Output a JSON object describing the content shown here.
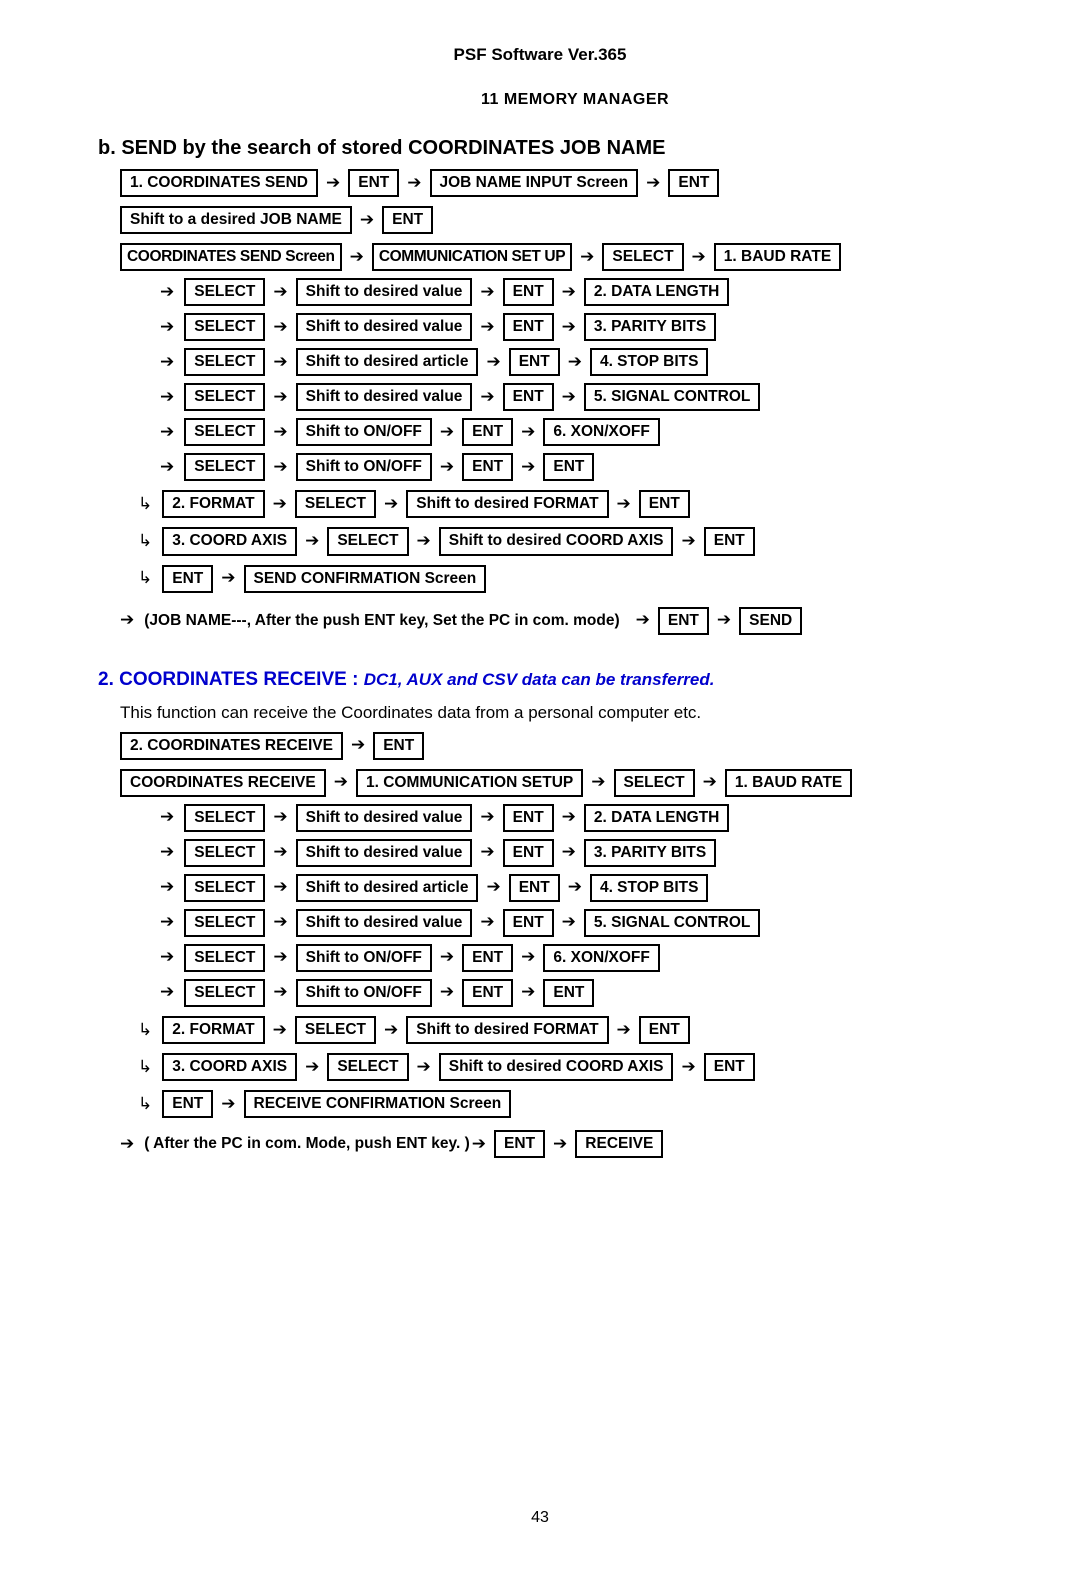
{
  "header": {
    "software": "PSF Software Ver.365",
    "chapter": "11  MEMORY MANAGER"
  },
  "section_b": {
    "title": "b. SEND by the search of stored COORDINATES JOB NAME",
    "rows": [
      {
        "items": [
          {
            "type": "box",
            "text": "1. COORDINATES SEND"
          },
          {
            "type": "arrow",
            "text": "➔"
          },
          {
            "type": "box",
            "text": "ENT"
          },
          {
            "type": "arrow",
            "text": "➔"
          },
          {
            "type": "box",
            "text": "JOB NAME INPUT Screen"
          },
          {
            "type": "arrow",
            "text": "➔"
          },
          {
            "type": "box",
            "text": "ENT"
          }
        ]
      },
      {
        "items": [
          {
            "type": "box",
            "text": "Shift to a desired JOB NAME"
          },
          {
            "type": "arrow",
            "text": "➔"
          },
          {
            "type": "box",
            "text": "ENT"
          }
        ]
      },
      {
        "items": [
          {
            "type": "box",
            "text": "COORDINATES SEND Screen"
          },
          {
            "type": "arrow",
            "text": "➔"
          },
          {
            "type": "box",
            "text": "COMMUNICATION SET UP"
          },
          {
            "type": "arrow",
            "text": "➔"
          },
          {
            "type": "box",
            "text": "SELECT"
          },
          {
            "type": "arrow",
            "text": "➔"
          },
          {
            "type": "box",
            "text": "1. BAUD RATE"
          }
        ]
      }
    ],
    "sub_rows": [
      {
        "items": [
          {
            "type": "arrow",
            "text": "➔"
          },
          {
            "type": "box",
            "text": "SELECT"
          },
          {
            "type": "arrow",
            "text": "➔"
          },
          {
            "type": "box",
            "text": "Shift to desired value"
          },
          {
            "type": "arrow",
            "text": "➔"
          },
          {
            "type": "box",
            "text": "ENT"
          },
          {
            "type": "arrow",
            "text": "➔"
          },
          {
            "type": "box",
            "text": "2. DATA LENGTH"
          }
        ]
      },
      {
        "items": [
          {
            "type": "arrow",
            "text": "➔"
          },
          {
            "type": "box",
            "text": "SELECT"
          },
          {
            "type": "arrow",
            "text": "➔"
          },
          {
            "type": "box",
            "text": "Shift to desired value"
          },
          {
            "type": "arrow",
            "text": "➔"
          },
          {
            "type": "box",
            "text": "ENT"
          },
          {
            "type": "arrow",
            "text": "➔"
          },
          {
            "type": "box",
            "text": "3. PARITY BITS"
          }
        ]
      },
      {
        "items": [
          {
            "type": "arrow",
            "text": "➔"
          },
          {
            "type": "box",
            "text": "SELECT"
          },
          {
            "type": "arrow",
            "text": "➔"
          },
          {
            "type": "box",
            "text": "Shift to desired article"
          },
          {
            "type": "arrow",
            "text": "➔"
          },
          {
            "type": "box",
            "text": "ENT"
          },
          {
            "type": "arrow",
            "text": "➔"
          },
          {
            "type": "box",
            "text": "4. STOP BITS"
          }
        ]
      },
      {
        "items": [
          {
            "type": "arrow",
            "text": "➔"
          },
          {
            "type": "box",
            "text": "SELECT"
          },
          {
            "type": "arrow",
            "text": "➔"
          },
          {
            "type": "box",
            "text": "Shift to desired value"
          },
          {
            "type": "arrow",
            "text": "➔"
          },
          {
            "type": "box",
            "text": "ENT"
          },
          {
            "type": "arrow",
            "text": "➔"
          },
          {
            "type": "box",
            "text": "5. SIGNAL CONTROL"
          }
        ]
      },
      {
        "items": [
          {
            "type": "arrow",
            "text": "➔"
          },
          {
            "type": "box",
            "text": "SELECT"
          },
          {
            "type": "arrow",
            "text": "➔"
          },
          {
            "type": "box",
            "text": "Shift to ON/OFF"
          },
          {
            "type": "arrow",
            "text": "➔"
          },
          {
            "type": "box",
            "text": "ENT"
          },
          {
            "type": "arrow",
            "text": "➔"
          },
          {
            "type": "box",
            "text": "6. XON/XOFF"
          }
        ]
      },
      {
        "items": [
          {
            "type": "arrow",
            "text": "➔"
          },
          {
            "type": "box",
            "text": "SELECT"
          },
          {
            "type": "arrow",
            "text": "➔"
          },
          {
            "type": "box",
            "text": "Shift to ON/OFF"
          },
          {
            "type": "arrow",
            "text": "➔"
          },
          {
            "type": "box",
            "text": "ENT"
          },
          {
            "type": "arrow",
            "text": "➔"
          },
          {
            "type": "box",
            "text": "ENT"
          }
        ]
      }
    ],
    "hook_rows": [
      {
        "items": [
          {
            "type": "arrow",
            "text": "↳"
          },
          {
            "type": "box",
            "text": "2. FORMAT"
          },
          {
            "type": "arrow",
            "text": "➔"
          },
          {
            "type": "box",
            "text": "SELECT"
          },
          {
            "type": "arrow",
            "text": "➔"
          },
          {
            "type": "box",
            "text": "Shift to desired FORMAT"
          },
          {
            "type": "arrow",
            "text": "➔"
          },
          {
            "type": "box",
            "text": "ENT"
          }
        ]
      },
      {
        "items": [
          {
            "type": "arrow",
            "text": "↳"
          },
          {
            "type": "box",
            "text": "3. COORD AXIS"
          },
          {
            "type": "arrow",
            "text": "➔"
          },
          {
            "type": "box",
            "text": "SELECT"
          },
          {
            "type": "arrow",
            "text": "➔"
          },
          {
            "type": "box",
            "text": "Shift to desired COORD AXIS"
          },
          {
            "type": "arrow",
            "text": "➔"
          },
          {
            "type": "box",
            "text": "ENT"
          }
        ]
      },
      {
        "items": [
          {
            "type": "arrow",
            "text": "↳"
          },
          {
            "type": "box",
            "text": "ENT"
          },
          {
            "type": "arrow",
            "text": "➔"
          },
          {
            "type": "box",
            "text": "SEND CONFIRMATION Screen"
          }
        ]
      }
    ],
    "final_row": {
      "arrow": "➔",
      "text": "(JOB NAME---, After the push ENT key, Set the PC in com. mode)",
      "arrow2": "➔",
      "box1": "ENT",
      "arrow3": "➔",
      "box2": "SEND"
    }
  },
  "section_2": {
    "number": "2. COORDINATES RECEIVE :",
    "note": "DC1, AUX and CSV data can be transferred.",
    "description": "This function can receive the Coordinates data from a personal computer etc.",
    "rows": [
      {
        "items": [
          {
            "type": "box",
            "text": "2. COORDINATES RECEIVE"
          },
          {
            "type": "arrow",
            "text": "➔"
          },
          {
            "type": "box",
            "text": "ENT"
          }
        ]
      },
      {
        "items": [
          {
            "type": "box",
            "text": "COORDINATES RECEIVE"
          },
          {
            "type": "arrow",
            "text": "➔"
          },
          {
            "type": "box",
            "text": "1. COMMUNICATION SETUP"
          },
          {
            "type": "arrow",
            "text": "➔"
          },
          {
            "type": "box",
            "text": "SELECT"
          },
          {
            "type": "arrow",
            "text": "➔"
          },
          {
            "type": "box",
            "text": "1. BAUD RATE"
          }
        ]
      }
    ],
    "sub_rows": [
      {
        "items": [
          {
            "type": "arrow",
            "text": "➔"
          },
          {
            "type": "box",
            "text": "SELECT"
          },
          {
            "type": "arrow",
            "text": "➔"
          },
          {
            "type": "box",
            "text": "Shift to desired value"
          },
          {
            "type": "arrow",
            "text": "➔"
          },
          {
            "type": "box",
            "text": "ENT"
          },
          {
            "type": "arrow",
            "text": "➔"
          },
          {
            "type": "box",
            "text": "2. DATA LENGTH"
          }
        ]
      },
      {
        "items": [
          {
            "type": "arrow",
            "text": "➔"
          },
          {
            "type": "box",
            "text": "SELECT"
          },
          {
            "type": "arrow",
            "text": "➔"
          },
          {
            "type": "box",
            "text": "Shift to desired value"
          },
          {
            "type": "arrow",
            "text": "➔"
          },
          {
            "type": "box",
            "text": "ENT"
          },
          {
            "type": "arrow",
            "text": "➔"
          },
          {
            "type": "box",
            "text": "3. PARITY BITS"
          }
        ]
      },
      {
        "items": [
          {
            "type": "arrow",
            "text": "➔"
          },
          {
            "type": "box",
            "text": "SELECT"
          },
          {
            "type": "arrow",
            "text": "➔"
          },
          {
            "type": "box",
            "text": "Shift to desired article"
          },
          {
            "type": "arrow",
            "text": "➔"
          },
          {
            "type": "box",
            "text": "ENT"
          },
          {
            "type": "arrow",
            "text": "➔"
          },
          {
            "type": "box",
            "text": "4. STOP BITS"
          }
        ]
      },
      {
        "items": [
          {
            "type": "arrow",
            "text": "➔"
          },
          {
            "type": "box",
            "text": "SELECT"
          },
          {
            "type": "arrow",
            "text": "➔"
          },
          {
            "type": "box",
            "text": "Shift to desired value"
          },
          {
            "type": "arrow",
            "text": "➔"
          },
          {
            "type": "box",
            "text": "ENT"
          },
          {
            "type": "arrow",
            "text": "➔"
          },
          {
            "type": "box",
            "text": "5. SIGNAL CONTROL"
          }
        ]
      },
      {
        "items": [
          {
            "type": "arrow",
            "text": "➔"
          },
          {
            "type": "box",
            "text": "SELECT"
          },
          {
            "type": "arrow",
            "text": "➔"
          },
          {
            "type": "box",
            "text": "Shift to ON/OFF"
          },
          {
            "type": "arrow",
            "text": "➔"
          },
          {
            "type": "box",
            "text": "ENT"
          },
          {
            "type": "arrow",
            "text": "➔"
          },
          {
            "type": "box",
            "text": "6. XON/XOFF"
          }
        ]
      },
      {
        "items": [
          {
            "type": "arrow",
            "text": "➔"
          },
          {
            "type": "box",
            "text": "SELECT"
          },
          {
            "type": "arrow",
            "text": "➔"
          },
          {
            "type": "box",
            "text": "Shift to ON/OFF"
          },
          {
            "type": "arrow",
            "text": "➔"
          },
          {
            "type": "box",
            "text": "ENT"
          },
          {
            "type": "arrow",
            "text": "➔"
          },
          {
            "type": "box",
            "text": "ENT"
          }
        ]
      }
    ],
    "hook_rows": [
      {
        "items": [
          {
            "type": "arrow",
            "text": "↳"
          },
          {
            "type": "box",
            "text": "2. FORMAT"
          },
          {
            "type": "arrow",
            "text": "➔"
          },
          {
            "type": "box",
            "text": "SELECT"
          },
          {
            "type": "arrow",
            "text": "➔"
          },
          {
            "type": "box",
            "text": "Shift to desired FORMAT"
          },
          {
            "type": "arrow",
            "text": "➔"
          },
          {
            "type": "box",
            "text": "ENT"
          }
        ]
      },
      {
        "items": [
          {
            "type": "arrow",
            "text": "↳"
          },
          {
            "type": "box",
            "text": "3. COORD AXIS"
          },
          {
            "type": "arrow",
            "text": "➔"
          },
          {
            "type": "box",
            "text": "SELECT"
          },
          {
            "type": "arrow",
            "text": "➔"
          },
          {
            "type": "box",
            "text": "Shift to desired COORD AXIS"
          },
          {
            "type": "arrow",
            "text": "➔"
          },
          {
            "type": "box",
            "text": "ENT"
          }
        ]
      },
      {
        "items": [
          {
            "type": "arrow",
            "text": "↳"
          },
          {
            "type": "box",
            "text": "ENT"
          },
          {
            "type": "arrow",
            "text": "➔"
          },
          {
            "type": "box",
            "text": "RECEIVE CONFIRMATION Screen"
          }
        ]
      }
    ],
    "final_row": {
      "arrow": "➔",
      "text": "( After the PC in com. Mode, push ENT key. )",
      "arrow2": "➔",
      "box1": "ENT",
      "arrow3": "➔",
      "box2": "RECEIVE"
    }
  },
  "footer": {
    "page_number": "43"
  }
}
